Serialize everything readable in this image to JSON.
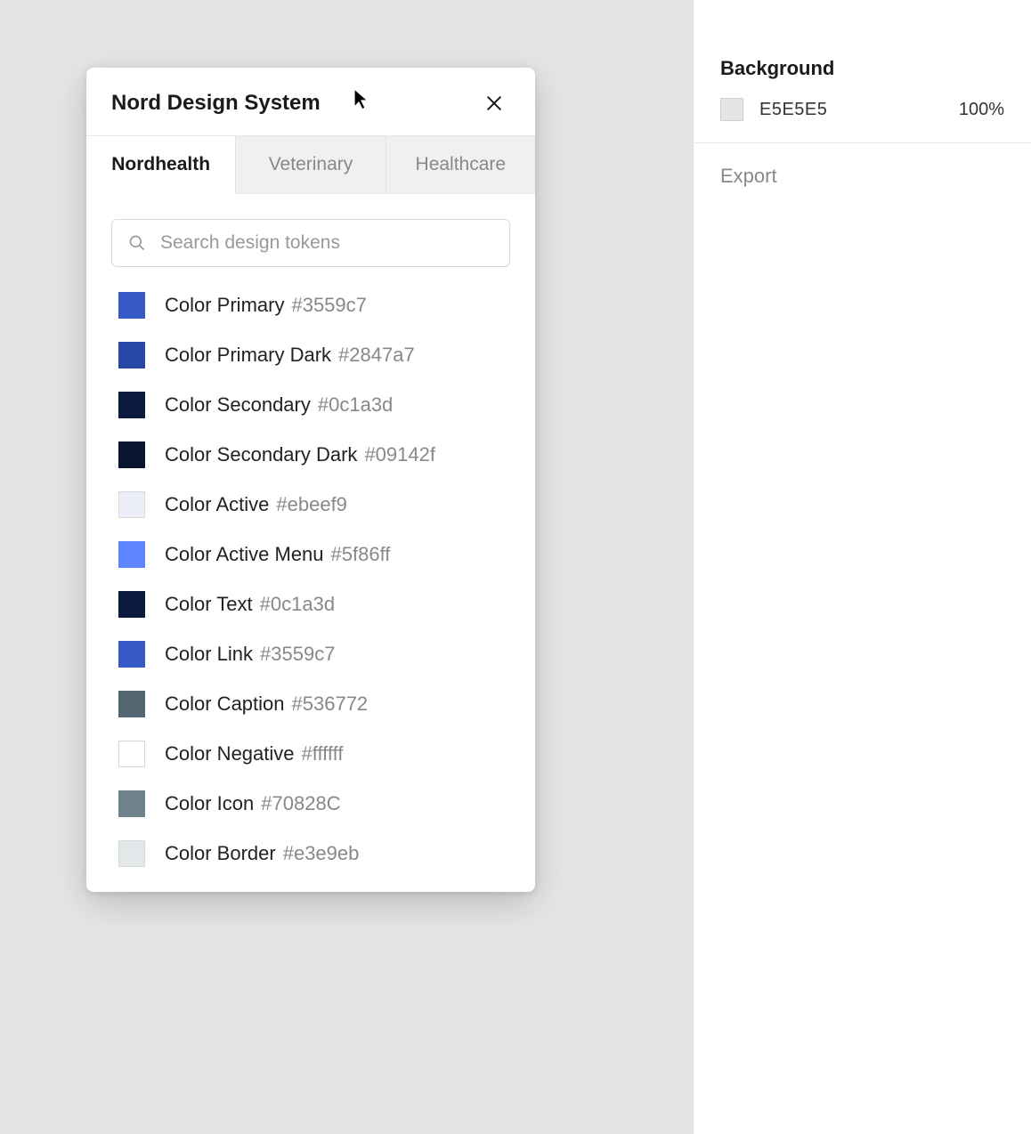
{
  "sidebar": {
    "background": {
      "title": "Background",
      "hex": "E5E5E5",
      "opacity": "100%",
      "swatch": "#e5e5e5"
    },
    "export": {
      "title": "Export"
    }
  },
  "modal": {
    "title": "Nord Design System",
    "tabs": [
      {
        "label": "Nordhealth",
        "active": true
      },
      {
        "label": "Veterinary",
        "active": false
      },
      {
        "label": "Healthcare",
        "active": false
      }
    ],
    "search": {
      "placeholder": "Search design tokens"
    },
    "tokens": [
      {
        "name": "Color Primary",
        "value": "#3559c7",
        "swatch": "#3559c7",
        "bordered": false
      },
      {
        "name": "Color Primary Dark",
        "value": "#2847a7",
        "swatch": "#2847a7",
        "bordered": false
      },
      {
        "name": "Color Secondary",
        "value": "#0c1a3d",
        "swatch": "#0c1a3d",
        "bordered": false
      },
      {
        "name": "Color Secondary Dark",
        "value": "#09142f",
        "swatch": "#09142f",
        "bordered": false
      },
      {
        "name": "Color Active",
        "value": "#ebeef9",
        "swatch": "#ebeef9",
        "bordered": true
      },
      {
        "name": "Color Active Menu",
        "value": "#5f86ff",
        "swatch": "#5f86ff",
        "bordered": false
      },
      {
        "name": "Color Text",
        "value": "#0c1a3d",
        "swatch": "#0c1a3d",
        "bordered": false
      },
      {
        "name": "Color Link",
        "value": "#3559c7",
        "swatch": "#3559c7",
        "bordered": false
      },
      {
        "name": "Color Caption",
        "value": "#536772",
        "swatch": "#536772",
        "bordered": false
      },
      {
        "name": "Color Negative",
        "value": "#ffffff",
        "swatch": "#ffffff",
        "bordered": true
      },
      {
        "name": "Color Icon",
        "value": "#70828C",
        "swatch": "#70828C",
        "bordered": false
      },
      {
        "name": "Color Border",
        "value": "#e3e9eb",
        "swatch": "#e3e9eb",
        "bordered": true
      }
    ]
  }
}
